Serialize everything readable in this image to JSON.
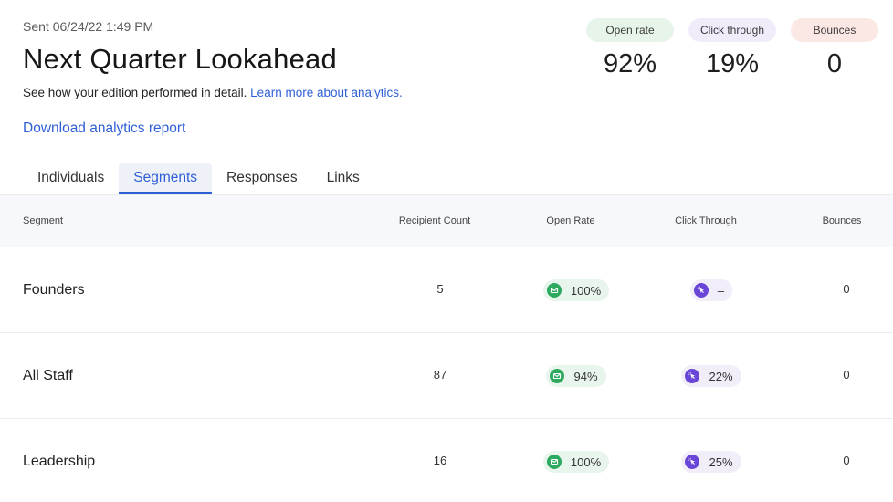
{
  "header": {
    "sent": "Sent 06/24/22 1:49 PM",
    "title": "Next Quarter Lookahead",
    "subtitle": "See how your edition performed in detail.",
    "learn_more": "Learn more about analytics.",
    "download": "Download analytics report"
  },
  "stats": [
    {
      "label": "Open rate",
      "value": "92%"
    },
    {
      "label": "Click through",
      "value": "19%"
    },
    {
      "label": "Bounces",
      "value": "0"
    }
  ],
  "tabs": [
    {
      "label": "Individuals"
    },
    {
      "label": "Segments",
      "active": true
    },
    {
      "label": "Responses"
    },
    {
      "label": "Links"
    }
  ],
  "table": {
    "columns": {
      "segment": "Segment",
      "recipient_count": "Recipient Count",
      "open_rate": "Open Rate",
      "click_through": "Click Through",
      "bounces": "Bounces"
    },
    "rows": [
      {
        "segment": "Founders",
        "recipient_count": "5",
        "open_rate": "100%",
        "click_through": "–",
        "bounces": "0"
      },
      {
        "segment": "All Staff",
        "recipient_count": "87",
        "open_rate": "94%",
        "click_through": "22%",
        "bounces": "0"
      },
      {
        "segment": "Leadership",
        "recipient_count": "16",
        "open_rate": "100%",
        "click_through": "25%",
        "bounces": "0"
      }
    ]
  },
  "icons": {
    "open_rate": "mail-icon",
    "click_through": "cursor-click-icon"
  },
  "colors": {
    "accent": "#2f5fd6",
    "open_green": "#2eaa5e",
    "click_purple": "#6a46d8"
  }
}
